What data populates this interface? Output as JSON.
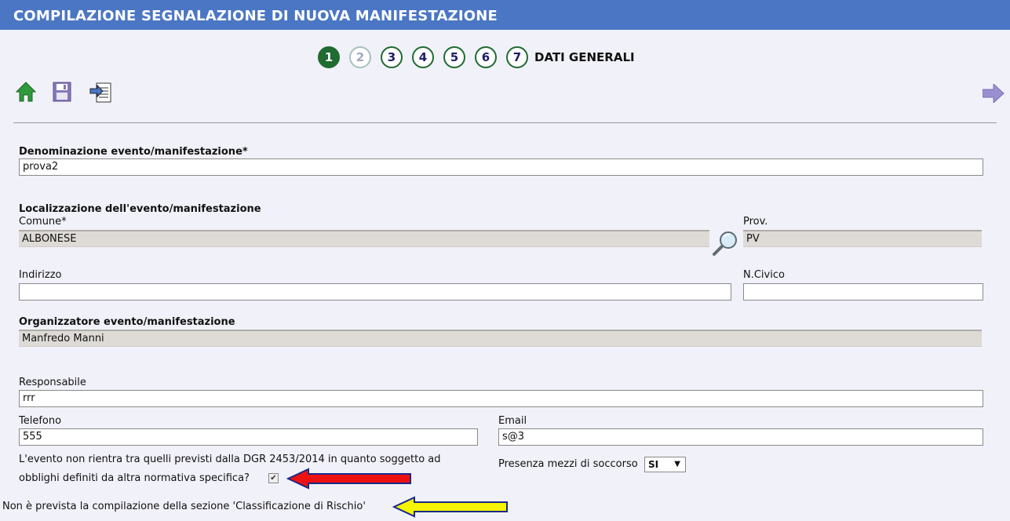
{
  "header": {
    "title": "COMPILAZIONE SEGNALAZIONE DI NUOVA MANIFESTAZIONE"
  },
  "steps": {
    "items": [
      "1",
      "2",
      "3",
      "4",
      "5",
      "6",
      "7"
    ],
    "current": "1",
    "title": "DATI GENERALI"
  },
  "toolbar": {
    "home": "home-icon",
    "save": "save-icon",
    "export": "export-icon",
    "next": "next-arrow-icon"
  },
  "form": {
    "denominazione": {
      "label": "Denominazione evento/manifestazione*",
      "value": "prova2"
    },
    "localizzazione": {
      "label": "Localizzazione dell'evento/manifestazione"
    },
    "comune": {
      "label": "Comune*",
      "value": "ALBONESE"
    },
    "prov": {
      "label": "Prov.",
      "value": "PV"
    },
    "indirizzo": {
      "label": "Indirizzo",
      "value": ""
    },
    "civico": {
      "label": "N.Civico",
      "value": ""
    },
    "organizzatore": {
      "label": "Organizzatore evento/manifestazione",
      "value": "Manfredo Manni"
    },
    "responsabile": {
      "label": "Responsabile",
      "value": "rrr"
    },
    "telefono": {
      "label": "Telefono",
      "value": "555"
    },
    "email": {
      "label": "Email",
      "value": "s@3"
    },
    "normativa": {
      "line1": "L'evento non rientra tra quelli previsti dalla DGR 2453/2014 in quanto soggetto ad",
      "line2": "obblighi definiti da altra normativa specifica?",
      "checked": true
    },
    "soccorso": {
      "label": "Presenza mezzi di soccorso",
      "value": "SI"
    },
    "note": "Non è prevista la compilazione della sezione 'Classificazione di Rischio'"
  },
  "colors": {
    "header": "#4a76c3",
    "step": "#1f6b31",
    "red_arrow": "#ee1111",
    "yellow_arrow": "#f5f500"
  }
}
